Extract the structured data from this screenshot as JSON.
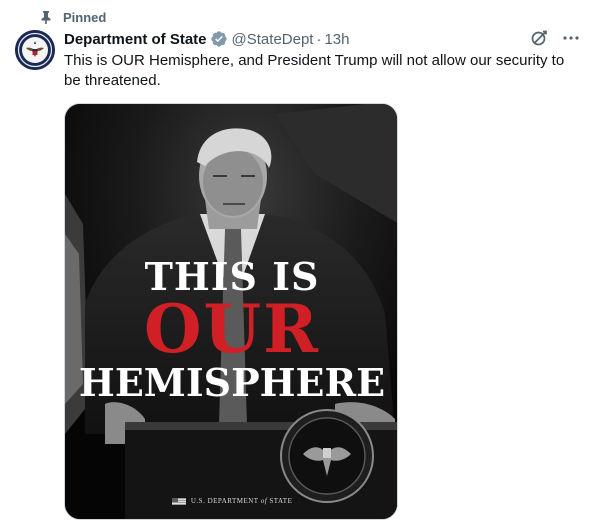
{
  "pinned": {
    "label": "Pinned",
    "icon": "pin-icon"
  },
  "author": {
    "display_name": "Department of State",
    "handle": "@StateDept",
    "separator": "·",
    "time": "13h",
    "verified_color": "#829aab",
    "avatar_icon": "state-department-seal"
  },
  "actions": {
    "grok_icon": "grok-icon",
    "more_icon": "more-icon"
  },
  "tweet": {
    "text": "This is OUR Hemisphere, and President Trump will not allow our security to be threatened."
  },
  "media": {
    "line1": "THIS IS",
    "line2": "OUR",
    "line3": "HEMISPHERE",
    "credit_prefix": "U.S. DEPARTMENT",
    "credit_of": "of",
    "credit_suffix": "STATE",
    "accent_color": "#d11f26"
  }
}
